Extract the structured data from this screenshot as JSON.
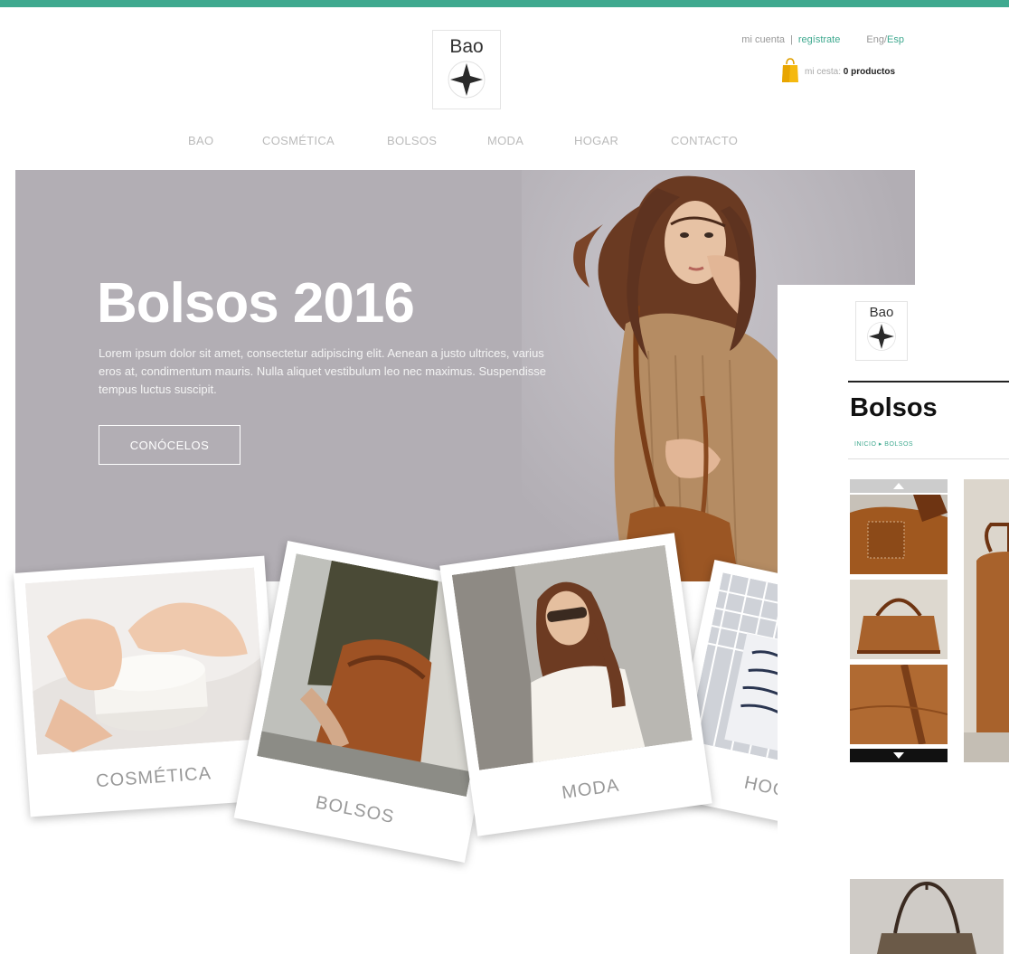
{
  "brand": {
    "logo_word": "Bao"
  },
  "header": {
    "account_link": "mi cuenta",
    "separator": "|",
    "register_link": "regístrate",
    "lang_eng": "Eng",
    "lang_sep": "/",
    "lang_esp": "Esp",
    "cart_label": "mi cesta:",
    "cart_count": "0 productos"
  },
  "nav": {
    "items": [
      "BAO",
      "COSMÉTICA",
      "BOLSOS",
      "MODA",
      "HOGAR",
      "CONTACTO"
    ]
  },
  "hero": {
    "title": "Bolsos 2016",
    "text": "Lorem ipsum dolor sit amet, consectetur adipiscing elit. Aenean a justo ultrices, varius eros at, condimentum mauris. Nulla aliquet vestibulum leo nec maximus. Suspendisse tempus luctus suscipit.",
    "button": "CONÓCELOS"
  },
  "categories": [
    {
      "label": "COSMÉTICA"
    },
    {
      "label": "BOLSOS"
    },
    {
      "label": "MODA"
    },
    {
      "label": "HOGA"
    }
  ],
  "detail_page": {
    "logo_word": "Bao",
    "title": "Bolsos",
    "breadcrumb": "INICIO ▸ BOLSOS"
  },
  "colors": {
    "accent": "#3fa98f",
    "hero_bg": "#b2aeb4",
    "leather": "#a8622c"
  }
}
